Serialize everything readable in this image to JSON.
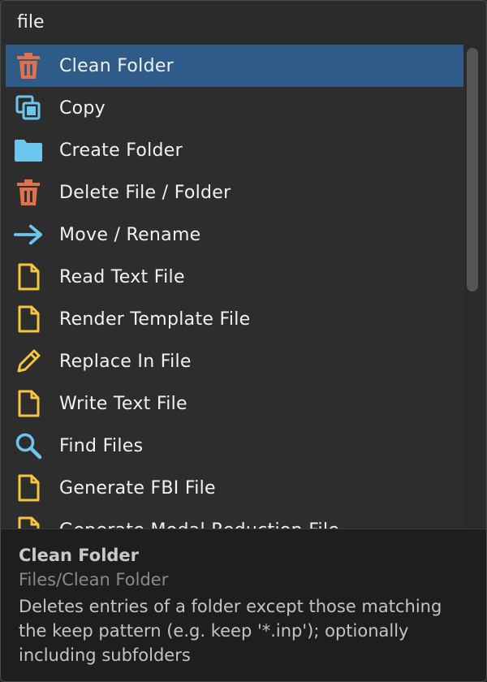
{
  "search": {
    "value": "file"
  },
  "items": [
    {
      "label": "Clean Folder",
      "icon": "trash-icon",
      "selected": true
    },
    {
      "label": "Copy",
      "icon": "copy-icon"
    },
    {
      "label": "Create Folder",
      "icon": "folder-icon"
    },
    {
      "label": "Delete File / Folder",
      "icon": "trash-icon"
    },
    {
      "label": "Move / Rename",
      "icon": "arrow-right-icon"
    },
    {
      "label": "Read Text File",
      "icon": "file-icon"
    },
    {
      "label": "Render Template File",
      "icon": "file-icon"
    },
    {
      "label": "Replace In File",
      "icon": "pencil-icon"
    },
    {
      "label": "Write Text File",
      "icon": "file-icon"
    },
    {
      "label": "Find Files",
      "icon": "search-icon"
    },
    {
      "label": "Generate FBI File",
      "icon": "file-icon"
    },
    {
      "label": "Generate Modal Reduction File",
      "icon": "file-icon"
    }
  ],
  "details": {
    "title": "Clean Folder",
    "path": "Files/Clean Folder",
    "description": "Deletes entries of a folder except those matching the keep pattern (e.g. keep '*.inp'); optionally including subfolders"
  },
  "colors": {
    "selected_bg": "#2e5b88",
    "trash": "#e0714a",
    "blue_icon": "#6cc6ee",
    "file_icon": "#f4c542"
  }
}
